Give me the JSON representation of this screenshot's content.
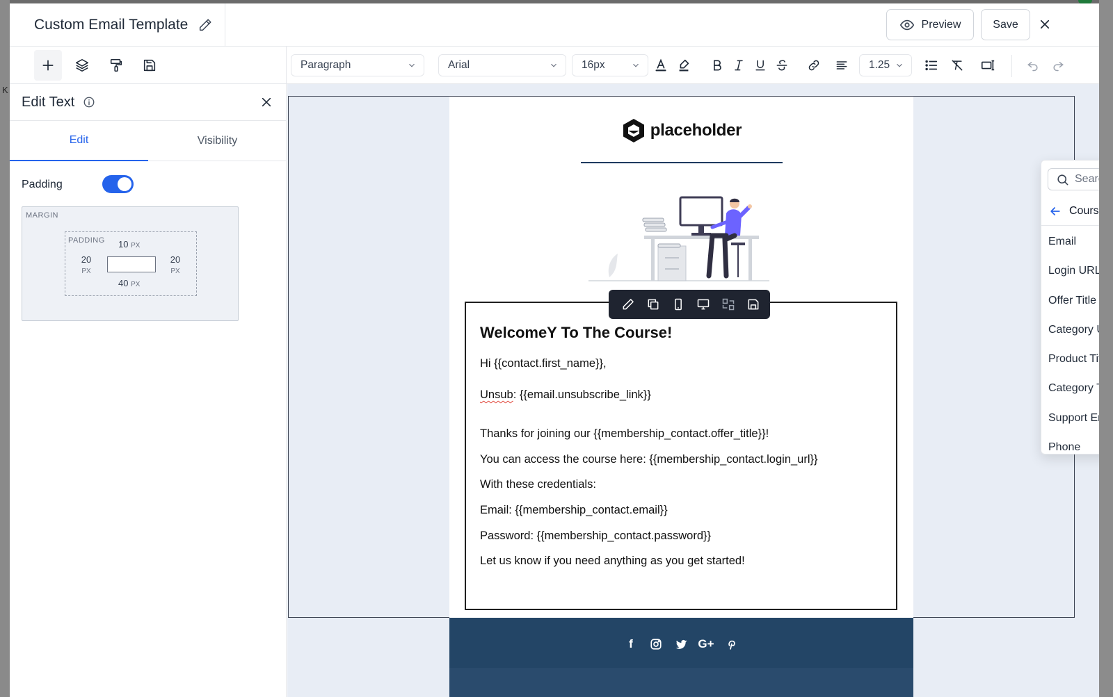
{
  "header": {
    "title": "Custom Email Template",
    "preview_label": "Preview",
    "save_label": "Save"
  },
  "background": {
    "edge_letter": "K"
  },
  "toolbar": {
    "block_type": "Paragraph",
    "font_family": "Arial",
    "font_size": "16px",
    "line_height": "1.25"
  },
  "panel": {
    "title": "Edit Text",
    "tabs": [
      "Edit",
      "Visibility"
    ],
    "padding_label": "Padding",
    "padding_enabled": true,
    "box_model": {
      "margin_label": "MARGIN",
      "padding_label": "PADDING",
      "top": "10",
      "right": "20",
      "bottom": "40",
      "left": "20",
      "unit": "PX"
    }
  },
  "email": {
    "logo_text": "placeholder",
    "heading": "WelcomeY To The Course!",
    "lines": [
      "Hi {{contact.first_name}},",
      "Unsub: {{email.unsubscribe_link}}",
      "Thanks for joining our {{membership_contact.offer_title}}!",
      "You can access the course here: {{membership_contact.login_url}}",
      "With these credentials:",
      "Email: {{membership_contact.email}}",
      "Password: {{membership_contact.password}}",
      "Let us know if you need anything as you get started!"
    ],
    "unsub_word": "Unsub",
    "unsub_rest": ": {{email.unsubscribe_link}}",
    "social_icons": [
      "facebook-icon",
      "instagram-icon",
      "twitter-icon",
      "google-plus-icon",
      "pinterest-icon"
    ]
  },
  "dropdown": {
    "search_placeholder": "Search",
    "back_label": "Courses",
    "items": [
      "Email",
      "Login URL (Magic Link)",
      "Offer Title",
      "Category URL",
      "Product Title",
      "Category Title",
      "Support Email",
      "Phone"
    ]
  },
  "colors": {
    "accent": "#2563eb",
    "footer": "#234566",
    "canvas_bg": "#e8edf5"
  }
}
